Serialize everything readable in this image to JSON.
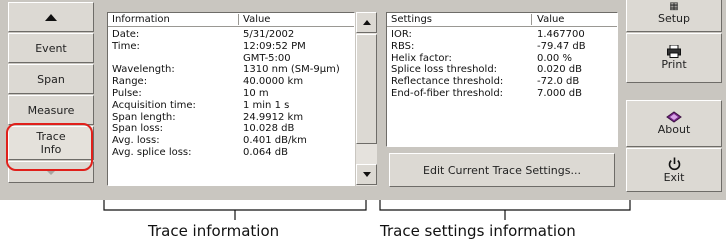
{
  "left_nav": {
    "items": [
      {
        "label": "Event"
      },
      {
        "label": "Span"
      },
      {
        "label": "Measure"
      },
      {
        "label": "Trace\nInfo"
      }
    ]
  },
  "trace_info": {
    "headers": {
      "col1": "Information",
      "col2": "Value"
    },
    "rows": [
      {
        "label": "Date:",
        "value": "5/31/2002"
      },
      {
        "label": "Time:",
        "value": "12:09:52 PM"
      },
      {
        "label": "",
        "value": "GMT-5:00"
      },
      {
        "label": "Wavelength:",
        "value": "1310 nm (SM-9µm)"
      },
      {
        "label": "Range:",
        "value": "40.0000 km"
      },
      {
        "label": "Pulse:",
        "value": "10 m"
      },
      {
        "label": "Acquisition time:",
        "value": "1 min 1 s"
      },
      {
        "label": "Span length:",
        "value": "24.9912 km"
      },
      {
        "label": "Span loss:",
        "value": "10.028 dB"
      },
      {
        "label": "Avg. loss:",
        "value": "0.401 dB/km"
      },
      {
        "label": "Avg. splice loss:",
        "value": "0.064 dB"
      }
    ]
  },
  "settings": {
    "headers": {
      "col1": "Settings",
      "col2": "Value"
    },
    "rows": [
      {
        "label": "IOR:",
        "value": "1.467700"
      },
      {
        "label": "RBS:",
        "value": "-79.47 dB"
      },
      {
        "label": "Helix factor:",
        "value": "0.00 %"
      },
      {
        "label": "Splice loss threshold:",
        "value": "0.020 dB"
      },
      {
        "label": "Reflectance threshold:",
        "value": "-72.0 dB"
      },
      {
        "label": "End-of-fiber threshold:",
        "value": "7.000 dB"
      }
    ],
    "edit_button_label": "Edit Current Trace Settings..."
  },
  "right_nav": {
    "setup_label": "Setup",
    "print_label": "Print",
    "about_label": "About",
    "exit_label": "Exit"
  },
  "callouts": {
    "trace_information": "Trace information",
    "trace_settings_information": "Trace settings information"
  },
  "colors": {
    "highlight_ring": "#e0201b",
    "about_icon": "#7a2a8c"
  },
  "icons": {
    "setup": "setup-icon",
    "print": "printer-icon",
    "about": "about-icon",
    "exit": "power-icon",
    "scroll_up": "arrow-up-icon",
    "scroll_down": "arrow-down-icon"
  }
}
